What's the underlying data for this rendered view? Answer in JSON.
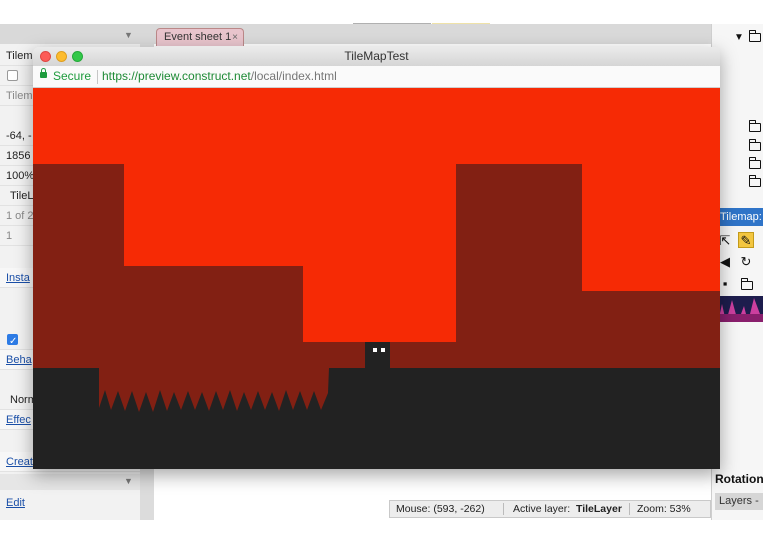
{
  "editor": {
    "tab_label": "Event sheet 1",
    "tab_close": "×",
    "left_panel": {
      "row_header": "Tilem",
      "row_tilemap": "Tilem",
      "row_position": "-64, -",
      "row_size": "1856",
      "row_opacity": "100%",
      "row_tilelayer": "TileL",
      "row_pages": "1 of 2",
      "row_one": "1",
      "link_instance": "Insta",
      "link_behaviors": "Beha",
      "row_normal": "Norm",
      "link_effects": "Effec",
      "link_create": "Creat",
      "link_edit": "Edit"
    },
    "right_panel": {
      "tilemap_bar": "Tilemap: T",
      "rotation": "Rotation",
      "layers_tab": "Layers - "
    },
    "status": {
      "mouse": "Mouse: (593, -262)",
      "active_layer_label": "Active layer:",
      "active_layer_value": "TileLayer",
      "zoom": "Zoom: 53%"
    }
  },
  "browser": {
    "window_title": "TileMapTest",
    "secure_label": "Secure",
    "url_main": "https://preview.construct.net",
    "url_rest": "/local/index.html"
  },
  "game": {
    "sky_color": "#f62a05",
    "mid_color": "#822013",
    "ground_color": "#222222",
    "player_color": "#222222",
    "eye_color": "#ffffff"
  }
}
